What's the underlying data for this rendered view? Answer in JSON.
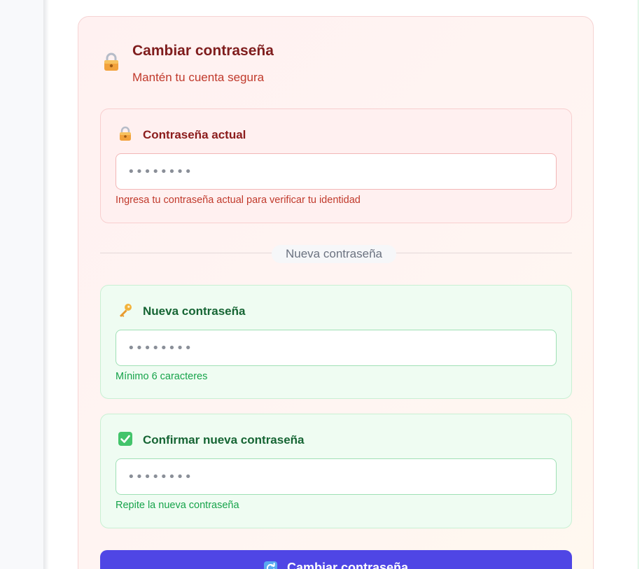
{
  "header": {
    "title": "Cambiar contraseña",
    "subtitle": "Mantén tu cuenta segura",
    "icon": "lock-icon"
  },
  "fields": {
    "current": {
      "icon": "lock-icon",
      "label": "Contraseña actual",
      "placeholder": "••••••••",
      "help": "Ingresa tu contraseña actual para verificar tu identidad"
    },
    "new": {
      "icon": "key-icon",
      "label": "Nueva contraseña",
      "placeholder": "••••••••",
      "help": "Mínimo 6 caracteres"
    },
    "confirm": {
      "icon": "check-box-icon",
      "label": "Confirmar nueva contraseña",
      "placeholder": "••••••••",
      "help": "Repite la nueva contraseña"
    }
  },
  "divider": {
    "label": "Nueva contraseña"
  },
  "submit": {
    "label": "Cambiar contraseña",
    "icon": "refresh-icon"
  },
  "colors": {
    "danger": "#c0392b",
    "success": "#16a34a",
    "primary": "#4f46e5"
  }
}
